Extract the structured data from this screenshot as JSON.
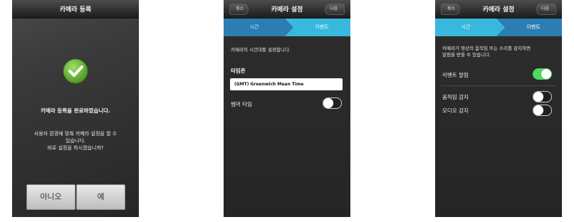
{
  "screen1": {
    "title": "카메라 등록",
    "message": "카메라 등록을 완료하였습니다.",
    "prompt_line1": "사용자 환경에 맞춰 카메라 설정을 할 수",
    "prompt_line2": "있습니다.",
    "prompt_line3": "바로 설정을 하시겠습니까?",
    "no_label": "아니오",
    "yes_label": "예"
  },
  "screen2": {
    "title": "카메라 설정",
    "cancel_label": "취소",
    "next_label": "다음",
    "tabs": [
      "시간",
      "이벤트"
    ],
    "intro": "카메라의 시간대를 설정합니다.",
    "timezone_label": "타임존",
    "timezone_value": "(GMT) Greenwich Mean Time",
    "summer_time_label": "썸머 타임",
    "summer_time_on": false
  },
  "screen3": {
    "title": "카메라 설정",
    "cancel_label": "취소",
    "next_label": "다음",
    "tabs": [
      "시간",
      "이벤트"
    ],
    "intro_line1": "카메라가 영상의 움직임 또는 소리를 감지하면",
    "intro_line2": "알림을 받을 수 있습니다.",
    "event_alarm_label": "이벤트 알림",
    "event_alarm_on": true,
    "motion_label": "움직임 감지",
    "motion_on": false,
    "audio_label": "오디오 감지",
    "audio_on": false
  },
  "colors": {
    "tab_active": "#39b8de",
    "tab_inactive": "#2b7db3",
    "check_green": "#6dbb3a",
    "toggle_on": "#4cd964"
  }
}
